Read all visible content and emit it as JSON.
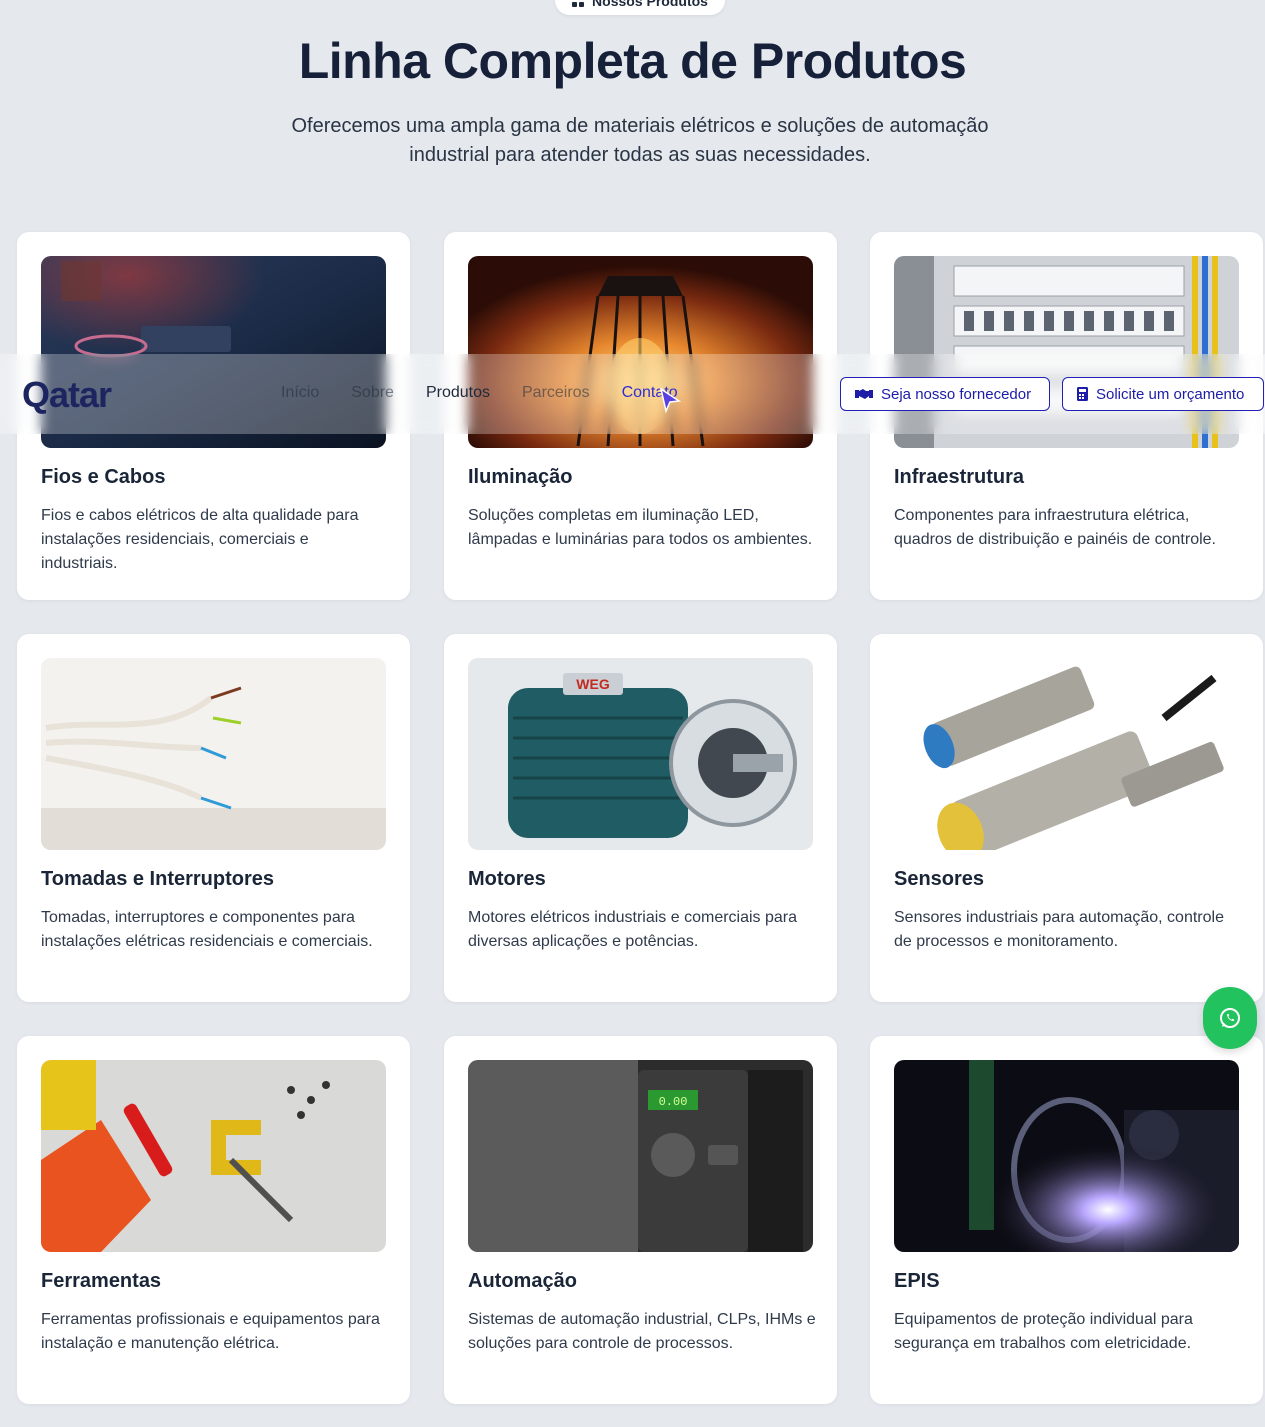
{
  "section": {
    "badge": "Nossos Produtos",
    "title": "Linha Completa de Produtos",
    "subtitle": "Oferecemos uma ampla gama de materiais elétricos e soluções de automação industrial para atender todas as suas necessidades."
  },
  "navbar": {
    "logo": "Qatar",
    "links": [
      "Início",
      "Sobre",
      "Produtos",
      "Parceiros",
      "Contato"
    ],
    "supplier_button": "Seja nosso fornecedor",
    "quote_button": "Solicite um orçamento",
    "supplier_icon": "handshake-icon",
    "quote_icon": "calculator-icon"
  },
  "products": [
    {
      "title": "Fios e Cabos",
      "description": "Fios e cabos elétricos de alta qualidade para instalações residenciais, comerciais e industriais."
    },
    {
      "title": "Iluminação",
      "description": "Soluções completas em iluminação LED, lâmpadas e luminárias para todos os ambientes."
    },
    {
      "title": "Infraestrutura",
      "description": "Componentes para infraestrutura elétrica, quadros de distribuição e painéis de controle."
    },
    {
      "title": "Tomadas e Interruptores",
      "description": "Tomadas, interruptores e componentes para instalações elétricas residenciais e comerciais."
    },
    {
      "title": "Motores",
      "description": "Motores elétricos industriais e comerciais para diversas aplicações e potências."
    },
    {
      "title": "Sensores",
      "description": "Sensores industriais para automação, controle de processos e monitoramento."
    },
    {
      "title": "Ferramentas",
      "description": "Ferramentas profissionais e equipamentos para instalação e manutenção elétrica."
    },
    {
      "title": "Automação",
      "description": "Sistemas de automação industrial, CLPs, IHMs e soluções para controle de processos."
    },
    {
      "title": "EPIS",
      "description": "Equipamentos de proteção individual para segurança em trabalhos com eletricidade."
    }
  ],
  "images": {
    "motor_brand": "WEG",
    "drive_display": "0.00"
  },
  "whatsapp": {
    "icon": "whatsapp-icon"
  },
  "colors": {
    "accent": "#2121b5",
    "whatsapp": "#22c35e",
    "title": "#162139",
    "background": "#e5e9ee"
  }
}
